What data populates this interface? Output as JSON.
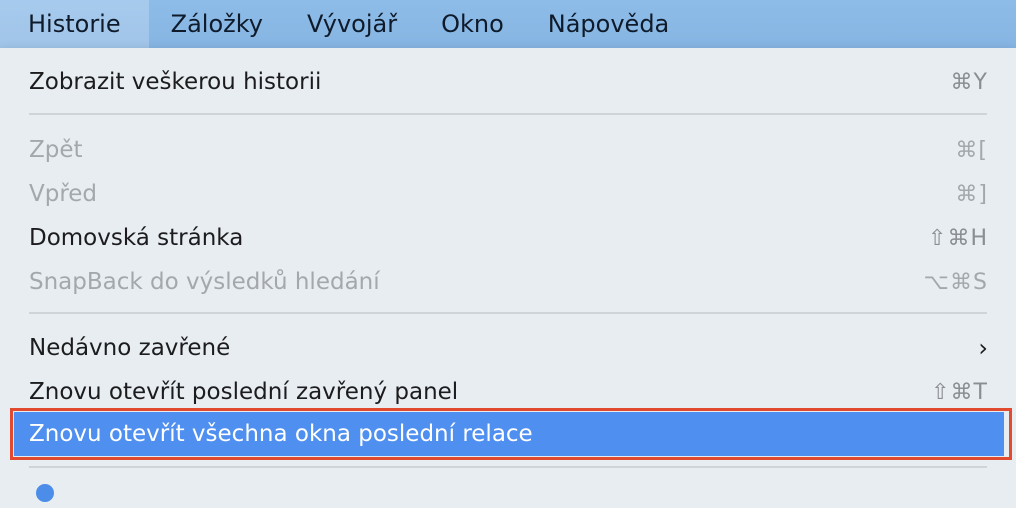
{
  "menubar": {
    "items": [
      {
        "label": "Historie",
        "active": true
      },
      {
        "label": "Záložky"
      },
      {
        "label": "Vývojář"
      },
      {
        "label": "Okno"
      },
      {
        "label": "Nápověda"
      }
    ]
  },
  "menu": {
    "items": [
      {
        "label": "Zobrazit veškerou historii",
        "shortcut": "⌘Y"
      },
      {
        "label": "Zpět",
        "shortcut": "⌘[",
        "disabled": true
      },
      {
        "label": "Vpřed",
        "shortcut": "⌘]",
        "disabled": true
      },
      {
        "label": "Domovská stránka",
        "shortcut": "⇧⌘H"
      },
      {
        "label": "SnapBack do výsledků hledání",
        "shortcut": "⌥⌘S",
        "disabled": true
      },
      {
        "label": "Nedávno zavřené",
        "submenu_glyph": "›"
      },
      {
        "label": "Znovu otevřít poslední zavřený panel",
        "shortcut": "⇧⌘T"
      },
      {
        "label": "Znovu otevřít všechna okna poslední relace",
        "highlighted": true
      }
    ]
  },
  "colors": {
    "highlight": "#4f8ff0",
    "annotation_box": "#e04a2f"
  }
}
